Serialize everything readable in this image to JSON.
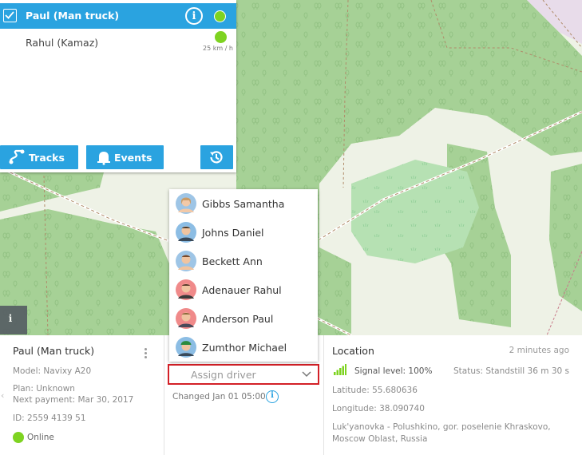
{
  "objects": [
    {
      "name": "Paul (Man truck)",
      "selected": true,
      "status_color": "#7ed321"
    },
    {
      "name": "Rahul (Kamaz)",
      "selected": false,
      "speed": "25 km / h",
      "status_color": "#7ed321"
    }
  ],
  "toolbar": {
    "tracks_label": "Tracks",
    "events_label": "Events"
  },
  "drivers": [
    {
      "name": "Gibbs Samantha",
      "avatar_color": "#9ec5e6"
    },
    {
      "name": "Johns Daniel",
      "avatar_color": "#8cbde4"
    },
    {
      "name": "Beckett Ann",
      "avatar_color": "#9ec5e6"
    },
    {
      "name": "Adenauer Rahul",
      "avatar_color": "#f08a8a"
    },
    {
      "name": "Anderson Paul",
      "avatar_color": "#f08a8a"
    },
    {
      "name": "Zumthor Michael",
      "avatar_color": "#8cbde4"
    }
  ],
  "object_card": {
    "title": "Paul (Man truck)",
    "model": "Model: Navixy A20",
    "plan": "Plan: Unknown",
    "next_payment": "Next payment: Mar 30, 2017",
    "id": "ID: 2559 4139 51",
    "status": "Online"
  },
  "driver_card": {
    "assign_placeholder": "Assign driver",
    "changed": "Changed Jan 01 05:00"
  },
  "location_card": {
    "title": "Location",
    "time_ago": "2 minutes ago",
    "signal": "Signal level: 100%",
    "status": "Status: Standstill 36 m 30 s",
    "latitude": "Latitude: 55.680636",
    "longitude": "Longitude: 38.090740",
    "address_line1": "Luk'yanovka - Polushkino, gor. poselenie Khraskovo,",
    "address_line2": "Moscow Oblast, Russia"
  },
  "colors": {
    "accent": "#2aa3e0",
    "online": "#7ed321",
    "highlight_border": "#d32027",
    "forest": "#a3cf93",
    "map_bg": "#e9f0e2"
  },
  "icons": {
    "tracks": "route-icon",
    "events": "bell-icon",
    "history": "history-icon",
    "info": "info-icon",
    "signal": "signal-icon",
    "chevron": "chevron-down-icon"
  }
}
